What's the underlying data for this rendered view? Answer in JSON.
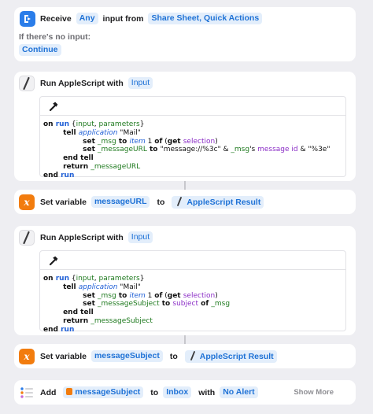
{
  "receive": {
    "prefix": "Receive",
    "type": "Any",
    "middle": "input from",
    "sources": "Share Sheet, Quick Actions",
    "no_input_label": "If there's no input:",
    "no_input_action": "Continue"
  },
  "script1": {
    "title": "Run AppleScript with",
    "input_token": "Input",
    "lines": [
      [
        {
          "t": "on ",
          "c": "kw"
        },
        {
          "t": "run",
          "c": "kw blue"
        },
        {
          "t": " {",
          "c": ""
        },
        {
          "t": "input",
          "c": "green"
        },
        {
          "t": ", ",
          "c": ""
        },
        {
          "t": "parameters",
          "c": "green"
        },
        {
          "t": "}",
          "c": ""
        }
      ],
      [
        {
          "t": "        tell ",
          "c": "kw"
        },
        {
          "t": "application",
          "c": "blue italic"
        },
        {
          "t": " \"Mail\"",
          "c": ""
        }
      ],
      [
        {
          "t": "                set ",
          "c": "kw"
        },
        {
          "t": "_msg",
          "c": "green"
        },
        {
          "t": " to ",
          "c": "kw"
        },
        {
          "t": "item",
          "c": "blue italic"
        },
        {
          "t": " 1 ",
          "c": ""
        },
        {
          "t": "of",
          "c": "kw"
        },
        {
          "t": " (",
          "c": ""
        },
        {
          "t": "get ",
          "c": "kw"
        },
        {
          "t": "selection",
          "c": "purple"
        },
        {
          "t": ")",
          "c": ""
        }
      ],
      [
        {
          "t": "                set ",
          "c": "kw"
        },
        {
          "t": "_messageURL",
          "c": "green"
        },
        {
          "t": " to ",
          "c": "kw"
        },
        {
          "t": "\"message://%3c\" & ",
          "c": ""
        },
        {
          "t": "_msg",
          "c": "green"
        },
        {
          "t": "'s ",
          "c": ""
        },
        {
          "t": "message id",
          "c": "purple"
        },
        {
          "t": " & \"%3e\"",
          "c": ""
        }
      ],
      [
        {
          "t": "        end tell",
          "c": "kw"
        }
      ],
      [
        {
          "t": "        return ",
          "c": "kw"
        },
        {
          "t": "_messageURL",
          "c": "green"
        }
      ],
      [
        {
          "t": "end ",
          "c": "kw"
        },
        {
          "t": "run",
          "c": "kw blue"
        }
      ]
    ]
  },
  "setvar1": {
    "label": "Set variable",
    "variable": "messageURL",
    "to": "to",
    "value": "AppleScript Result"
  },
  "script2": {
    "title": "Run AppleScript with",
    "input_token": "Input",
    "lines": [
      [
        {
          "t": "on ",
          "c": "kw"
        },
        {
          "t": "run",
          "c": "kw blue"
        },
        {
          "t": " {",
          "c": ""
        },
        {
          "t": "input",
          "c": "green"
        },
        {
          "t": ", ",
          "c": ""
        },
        {
          "t": "parameters",
          "c": "green"
        },
        {
          "t": "}",
          "c": ""
        }
      ],
      [
        {
          "t": "        tell ",
          "c": "kw"
        },
        {
          "t": "application",
          "c": "blue italic"
        },
        {
          "t": " \"Mail\"",
          "c": ""
        }
      ],
      [
        {
          "t": "                set ",
          "c": "kw"
        },
        {
          "t": "_msg",
          "c": "green"
        },
        {
          "t": " to ",
          "c": "kw"
        },
        {
          "t": "item",
          "c": "blue italic"
        },
        {
          "t": " 1 ",
          "c": ""
        },
        {
          "t": "of",
          "c": "kw"
        },
        {
          "t": " (",
          "c": ""
        },
        {
          "t": "get ",
          "c": "kw"
        },
        {
          "t": "selection",
          "c": "purple"
        },
        {
          "t": ")",
          "c": ""
        }
      ],
      [
        {
          "t": "                set ",
          "c": "kw"
        },
        {
          "t": "_messageSubject",
          "c": "green"
        },
        {
          "t": " to ",
          "c": "kw"
        },
        {
          "t": "subject",
          "c": "purple"
        },
        {
          "t": " of ",
          "c": "kw"
        },
        {
          "t": "_msg",
          "c": "green"
        }
      ],
      [
        {
          "t": "        end tell",
          "c": "kw"
        }
      ],
      [
        {
          "t": "        return ",
          "c": "kw"
        },
        {
          "t": "_messageSubject",
          "c": "green"
        }
      ],
      [
        {
          "t": "end ",
          "c": "kw"
        },
        {
          "t": "run",
          "c": "kw blue"
        }
      ]
    ]
  },
  "setvar2": {
    "label": "Set variable",
    "variable": "messageSubject",
    "to": "to",
    "value": "AppleScript Result"
  },
  "add": {
    "label": "Add",
    "item": "messageSubject",
    "to": "to",
    "list": "Inbox",
    "with": "with",
    "alert": "No Alert",
    "show_more": "Show More"
  },
  "colors": {
    "accent": "#1f72d6",
    "token_bg": "#e3eefb",
    "variable_icon": "#f27c0e",
    "shortcuts_icon": "#2b7de9"
  },
  "icons": {
    "receive": "shortcuts-icon",
    "script": "applescript-icon",
    "variable": "variable-icon",
    "compile": "hammer-icon",
    "reminders": "reminders-list-icon"
  }
}
